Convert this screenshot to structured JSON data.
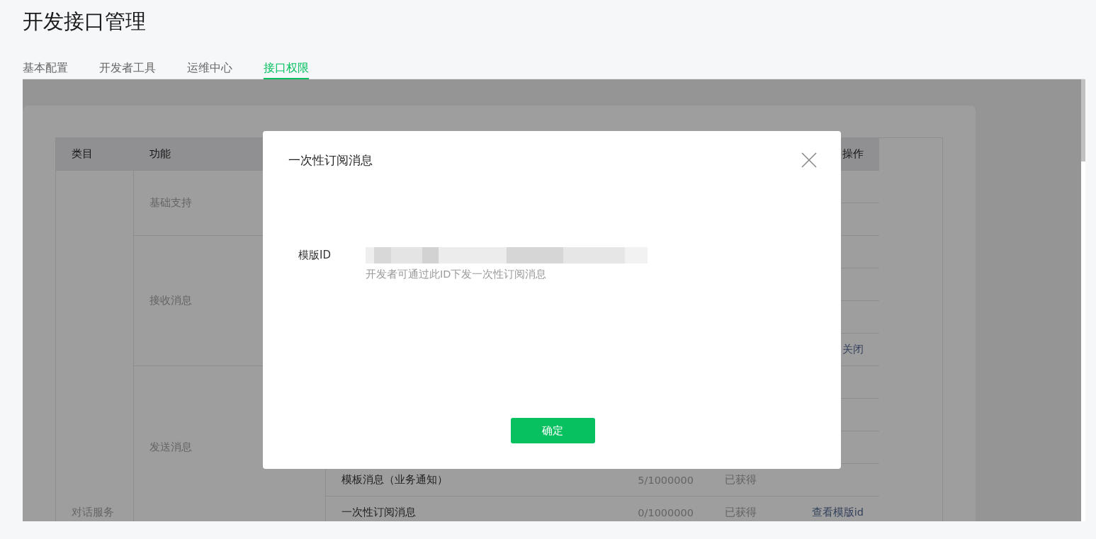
{
  "page": {
    "title": "开发接口管理"
  },
  "tabs": [
    {
      "label": "基本配置",
      "selected": false
    },
    {
      "label": "开发者工具",
      "selected": false
    },
    {
      "label": "运维中心",
      "selected": false
    },
    {
      "label": "接口权限",
      "selected": true
    }
  ],
  "table": {
    "columns": {
      "category": "类目",
      "function": "功能",
      "action": "操作"
    },
    "category": "对话服务",
    "groups": [
      {
        "label": "基础支持",
        "rows": [
          {},
          {}
        ]
      },
      {
        "label": "接收消息",
        "rows": [
          {},
          {},
          {},
          {
            "action": "关闭"
          }
        ]
      },
      {
        "label": "发送消息",
        "rows": [
          {},
          {},
          {},
          {
            "name": "模板消息（业务通知）",
            "quota": "5/1000000",
            "status": "已获得"
          },
          {
            "name": "一次性订阅消息",
            "quota": "0/1000000",
            "status": "已获得",
            "action": "查看模版id"
          }
        ]
      }
    ]
  },
  "dialog": {
    "title": "一次性订阅消息",
    "field_label": "模版ID",
    "hint": "开发者可通过此ID下发一次性订阅消息",
    "confirm": "确定"
  }
}
